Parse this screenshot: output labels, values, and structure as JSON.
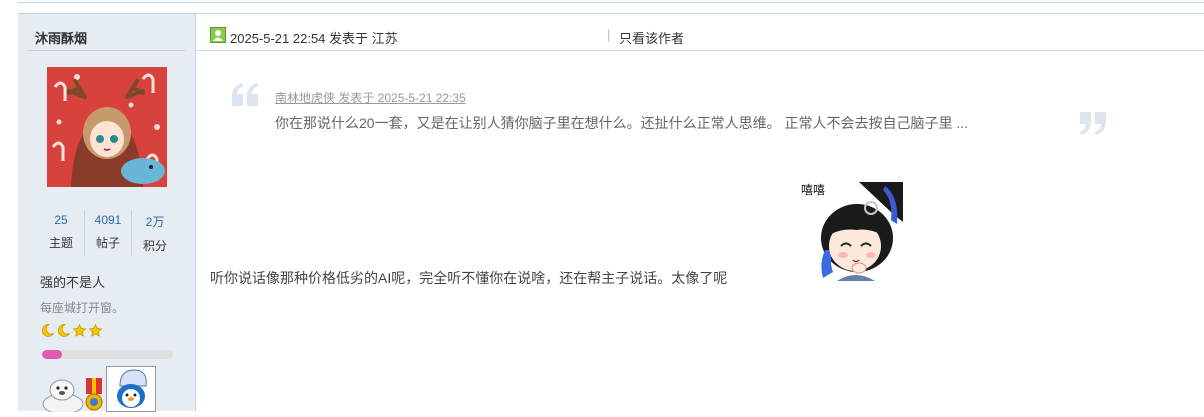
{
  "user": {
    "name": "沐雨酥烟",
    "stats": [
      {
        "value": "25",
        "label": "主题"
      },
      {
        "value": "4091",
        "label": "帖子"
      },
      {
        "value": "2万",
        "label": "积分"
      }
    ],
    "group": "强的不是人",
    "custom_title": "每座城打开窗。",
    "level_icons": [
      "moon-icon",
      "moon-icon",
      "star-icon",
      "star-icon"
    ],
    "level_progress_percent": 15,
    "medals": [
      "seal-medal-icon",
      "ribbon-medal-icon",
      "penguin-medal-icon"
    ]
  },
  "post": {
    "time_prefix": "2025-5-21 22:54 发表于 江苏",
    "separator": "|",
    "author_only": "只看该作者",
    "quote": {
      "meta": "南林地虎侠 发表于 2025-5-21 22:35",
      "text": "你在那说什么20一套，又是在让别人猜你脑子里在想什么。还扯什么正常人思维。 正常人不会去按自己脑子里 ..."
    },
    "sticker_caption": "嘻嘻",
    "message": "听你说话像那种价格低劣的AI呢，完全听不懂你在说啥，还在帮主子说话。太像了呢"
  },
  "colors": {
    "sidebar_bg": "#e5edf2",
    "border": "#c2d5e3",
    "link_blue": "#336699",
    "progress_fill": "#e25bb1",
    "quote_mark": "#dde6ee"
  }
}
